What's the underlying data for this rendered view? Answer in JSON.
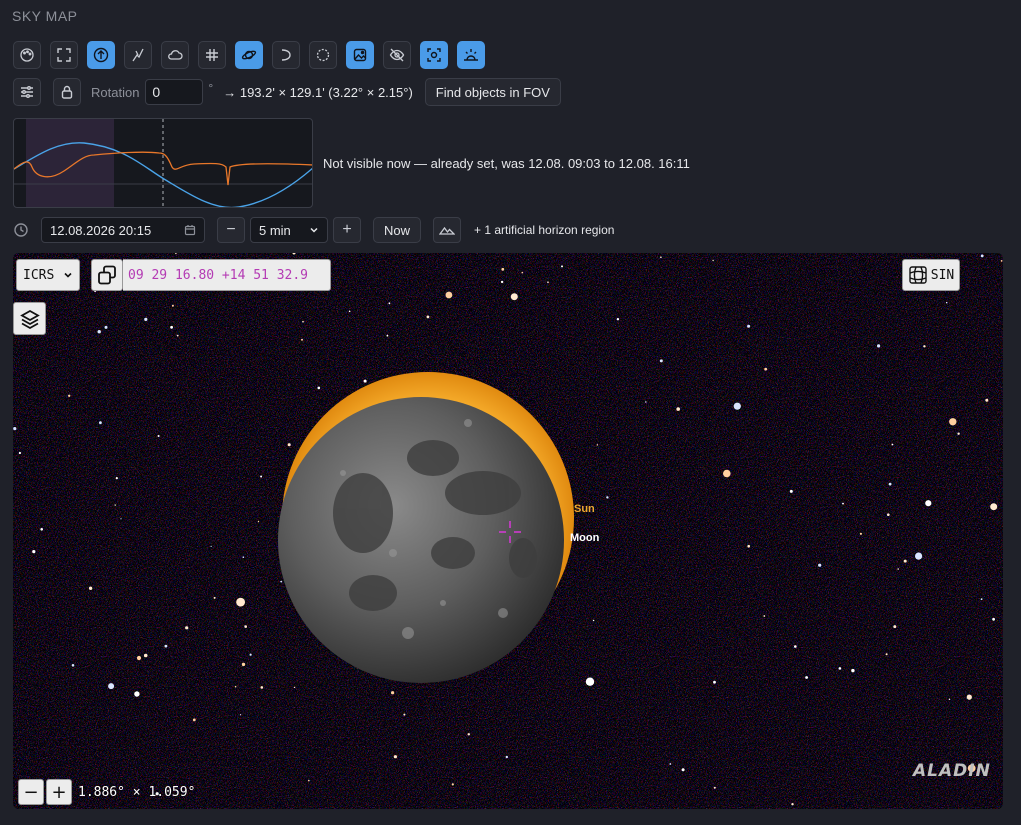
{
  "header": {
    "title": "SKY MAP"
  },
  "toolbar": {
    "buttons": [
      {
        "icon": "palette-icon",
        "active": false
      },
      {
        "icon": "fullscreen-icon",
        "active": false
      },
      {
        "icon": "north-up-icon",
        "active": true
      },
      {
        "icon": "constellation-icon",
        "active": false
      },
      {
        "icon": "cloud-icon",
        "active": false
      },
      {
        "icon": "grid-icon",
        "active": false
      },
      {
        "icon": "planet-icon",
        "active": true
      },
      {
        "icon": "ecliptic-icon",
        "active": false
      },
      {
        "icon": "outline-icon",
        "active": false
      },
      {
        "icon": "image-layer-icon",
        "active": true
      },
      {
        "icon": "hide-icon",
        "active": false
      },
      {
        "icon": "target-icon",
        "active": true
      },
      {
        "icon": "horizon-icon",
        "active": true
      }
    ]
  },
  "controls": {
    "settings_icon": "sliders-icon",
    "lock_icon": "lock-icon",
    "rotation_label": "Rotation",
    "rotation_value": "0",
    "degree_symbol": "°",
    "fov_text": "→ 193.2' × 129.1' (3.22° × 2.15°)",
    "find_button": "Find objects in FOV"
  },
  "visibility": {
    "status_text": "Not visible now — already set, was 12.08. 09:03 to 12.08. 16:11"
  },
  "time": {
    "clock_icon": "clock-icon",
    "datetime_value": "12.08.2026 20:15",
    "minus_label": "−",
    "step_value": "5 min",
    "plus_label": "+",
    "now_label": "Now",
    "horizon_icon": "mountain-icon",
    "horizon_text": "+ 1 artificial horizon region"
  },
  "aladin": {
    "frame": "ICRS",
    "coordinates": "09 29 16.80 +14 51 32.9",
    "projection": "SIN",
    "zoom_out": "−",
    "zoom_in": "+",
    "fov_label": "1.886° × 1.059°",
    "objects": [
      {
        "name": "Sun",
        "color": "#f0a830"
      },
      {
        "name": "Moon",
        "color": "#ffffff"
      }
    ],
    "logo": "ALADIN"
  },
  "colors": {
    "accent": "#4a9be8",
    "sun": "#f4a623",
    "altitude_curve": "#4aa3e8",
    "sun_curve": "#e8772a"
  }
}
